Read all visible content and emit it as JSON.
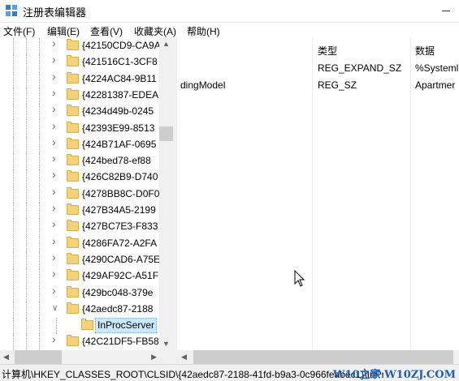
{
  "window": {
    "title": "注册表编辑器"
  },
  "menu": [
    {
      "label": "文件(F)"
    },
    {
      "label": "编辑(E)"
    },
    {
      "label": "查看(V)"
    },
    {
      "label": "收藏夹(A)"
    },
    {
      "label": "帮助(H)"
    }
  ],
  "tree": {
    "items": [
      {
        "label": "{42150CD9-CA9A",
        "expanded": false
      },
      {
        "label": "{421516C1-3CF8",
        "expanded": false
      },
      {
        "label": "{4224AC84-9B11",
        "expanded": false
      },
      {
        "label": "{42281387-EDEA",
        "expanded": false
      },
      {
        "label": "{4234d49b-0245",
        "expanded": false
      },
      {
        "label": "{42393E99-8513",
        "expanded": false
      },
      {
        "label": "{424B71AF-0695",
        "expanded": false
      },
      {
        "label": "{424bed78-ef88",
        "expanded": false
      },
      {
        "label": "{426C82B9-D740",
        "expanded": false
      },
      {
        "label": "{4278BB8C-D0F0",
        "expanded": false
      },
      {
        "label": "{427B34A5-2199",
        "expanded": false
      },
      {
        "label": "{427BC7E3-F833",
        "expanded": false
      },
      {
        "label": "{4286FA72-A2FA",
        "expanded": false
      },
      {
        "label": "{4290CAD6-A75E",
        "expanded": false
      },
      {
        "label": "{429AF92C-A51F",
        "expanded": false
      },
      {
        "label": "{429bc048-379e",
        "expanded": false
      },
      {
        "label": "{42aedc87-2188",
        "expanded": true
      },
      {
        "label": "InProcServer",
        "selected": true
      },
      {
        "label": "{42C21DF5-FB58",
        "expanded": false
      }
    ]
  },
  "values": {
    "columns": [
      {
        "label": ""
      },
      {
        "label": "类型"
      },
      {
        "label": "数据"
      }
    ],
    "rows": [
      {
        "name": "",
        "type": "REG_EXPAND_SZ",
        "data": "%Systeml"
      },
      {
        "name": "dingModel",
        "type": "REG_SZ",
        "data": "Apartmer"
      }
    ]
  },
  "statusbar": {
    "path": "计算机\\HKEY_CLASSES_ROOT\\CLSID\\{42aedc87-2188-41fd-b9a3-0c966feabec1}\\InProcServer32"
  },
  "watermark": {
    "text": "W10之家 W10ZJ.COM"
  },
  "colors": {
    "folder": "#f3d27a",
    "selection": "#cce8ff",
    "watermark": "#1e5fb4"
  }
}
